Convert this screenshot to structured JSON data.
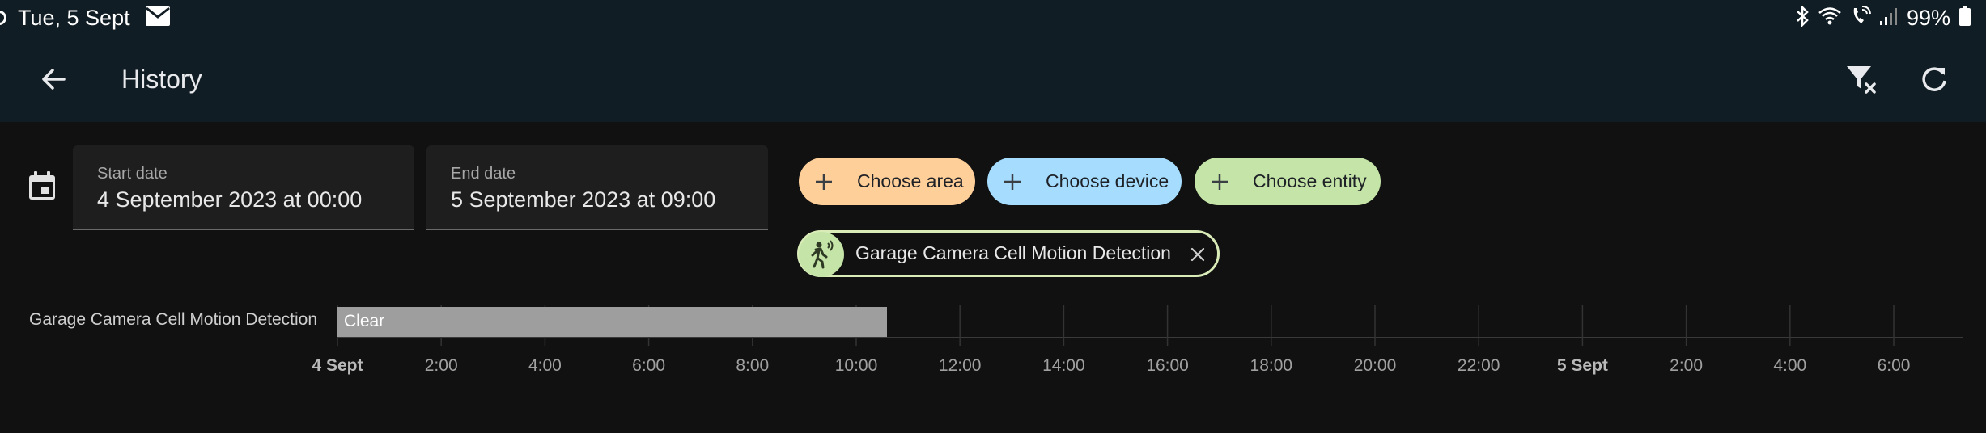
{
  "status_bar": {
    "date": "Tue, 5 Sept",
    "battery_text": "99%",
    "icons": [
      "notification-dot-icon",
      "mail-icon",
      "bluetooth-icon",
      "wifi-icon",
      "wifi-calling-icon",
      "signal-icon",
      "battery-icon"
    ]
  },
  "app_bar": {
    "title": "History",
    "back_icon": "arrow-back-icon",
    "actions": [
      "filter-remove-icon",
      "refresh-icon"
    ]
  },
  "date_range": {
    "icon": "calendar-icon",
    "start": {
      "label": "Start date",
      "value": "4 September 2023 at 00:00"
    },
    "end": {
      "label": "End date",
      "value": "5 September 2023 at 09:00"
    }
  },
  "target_picker": {
    "chips": [
      {
        "label": "Choose area",
        "color": "#ffcf99"
      },
      {
        "label": "Choose device",
        "color": "#a6ddff"
      },
      {
        "label": "Choose entity",
        "color": "#c5e4a8"
      }
    ],
    "selected": [
      {
        "label": "Garage Camera Cell Motion Detection",
        "icon": "motion-sensor-icon",
        "color": "#c5e4a8"
      }
    ]
  },
  "timeline": {
    "rows": [
      {
        "entity": "Garage Camera Cell Motion Detection",
        "segments": [
          {
            "state": "Clear",
            "start_hours": 0,
            "end_hours": 10.6,
            "color": "#9e9e9e"
          }
        ]
      }
    ],
    "range_hours": [
      0,
      33
    ],
    "ticks": [
      {
        "label": "4 Sept",
        "hour": 0,
        "bold": true
      },
      {
        "label": "2:00",
        "hour": 2,
        "bold": false
      },
      {
        "label": "4:00",
        "hour": 4,
        "bold": false
      },
      {
        "label": "6:00",
        "hour": 6,
        "bold": false
      },
      {
        "label": "8:00",
        "hour": 8,
        "bold": false
      },
      {
        "label": "10:00",
        "hour": 10,
        "bold": false
      },
      {
        "label": "12:00",
        "hour": 12,
        "bold": false
      },
      {
        "label": "14:00",
        "hour": 14,
        "bold": false
      },
      {
        "label": "16:00",
        "hour": 16,
        "bold": false
      },
      {
        "label": "18:00",
        "hour": 18,
        "bold": false
      },
      {
        "label": "20:00",
        "hour": 20,
        "bold": false
      },
      {
        "label": "22:00",
        "hour": 22,
        "bold": false
      },
      {
        "label": "5 Sept",
        "hour": 24,
        "bold": true
      },
      {
        "label": "2:00",
        "hour": 26,
        "bold": false
      },
      {
        "label": "4:00",
        "hour": 28,
        "bold": false
      },
      {
        "label": "6:00",
        "hour": 30,
        "bold": false
      }
    ]
  }
}
